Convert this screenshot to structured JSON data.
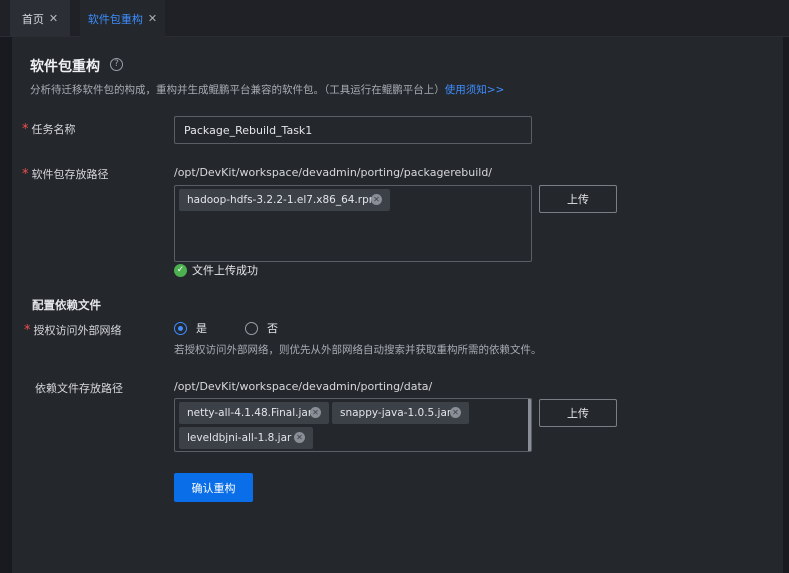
{
  "tabs": [
    {
      "label": "首页",
      "close": "✕"
    },
    {
      "label": "软件包重构",
      "close": "✕"
    }
  ],
  "page": {
    "title": "软件包重构",
    "help_glyph": "?",
    "description": "分析待迁移软件包的构成，重构并生成鲲鹏平台兼容的软件包。（工具运行在鲲鹏平台上）",
    "help_link": "使用须知>>"
  },
  "form": {
    "required_mark": "*",
    "task_name": {
      "label": "任务名称",
      "value": "Package_Rebuild_Task1"
    },
    "package_path": {
      "label": "软件包存放路径",
      "path": "/opt/DevKit/workspace/devadmin/porting/packagerebuild/",
      "files": [
        "hadoop-hdfs-3.2.2-1.el7.x86_64.rpm"
      ],
      "upload_label": "上传",
      "success_text": "文件上传成功"
    },
    "dependency": {
      "section_title": "配置依赖文件",
      "auth_label": "授权访问外部网络",
      "options": [
        "是",
        "否"
      ],
      "selected": "是",
      "hint": "若授权访问外部网络，则优先从外部网络自动搜索并获取重构所需的依赖文件。",
      "path_label": "依赖文件存放路径",
      "path": "/opt/DevKit/workspace/devadmin/porting/data/",
      "files": [
        "netty-all-4.1.48.Final.jar",
        "snappy-java-1.0.5.jar",
        "leveldbjni-all-1.8.jar"
      ],
      "upload_label": "上传"
    },
    "confirm_label": "确认重构"
  },
  "icons": {
    "close": "close-icon",
    "help": "help-circle-icon",
    "success": "check-circle-icon",
    "chip_remove": "remove-tag-icon"
  },
  "colors": {
    "accent": "#3d8eff",
    "primary_button": "#0a6ee8",
    "required": "#f0504d",
    "success": "#4caf50",
    "background": "#181a1f",
    "panel": "#24272c"
  }
}
